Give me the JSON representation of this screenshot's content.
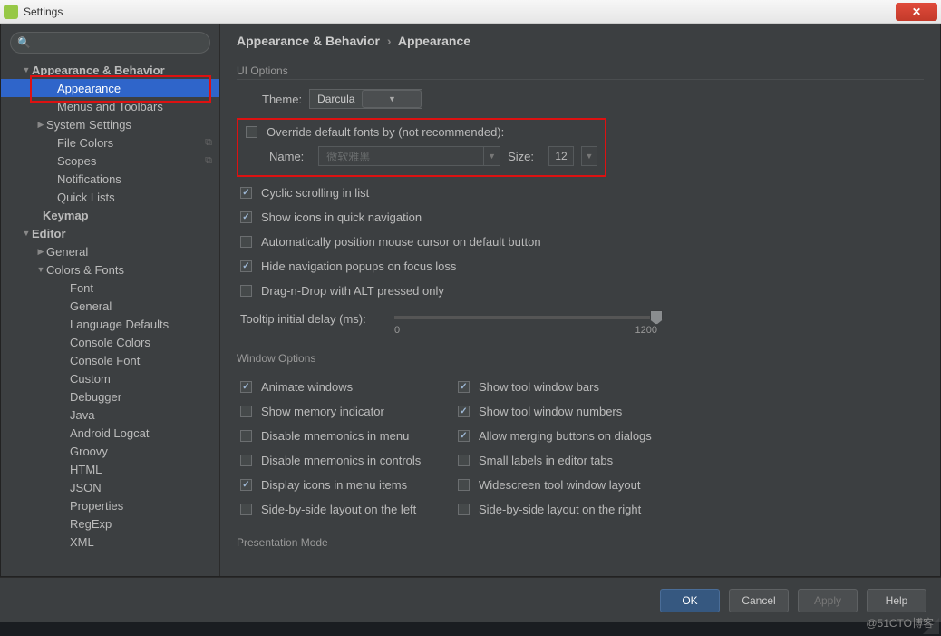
{
  "window": {
    "title": "Settings",
    "close_glyph": "✕"
  },
  "search": {
    "placeholder": "",
    "icon": "🔍"
  },
  "sidebar": {
    "items": [
      {
        "label": "Appearance & Behavior",
        "indent": 22,
        "arrow": "▼",
        "bold": true
      },
      {
        "label": "Appearance",
        "indent": 50,
        "selected": true,
        "redbox": true
      },
      {
        "label": "Menus and Toolbars",
        "indent": 50
      },
      {
        "label": "System Settings",
        "indent": 38,
        "arrow": "▶"
      },
      {
        "label": "File Colors",
        "indent": 50,
        "tail": "⧉"
      },
      {
        "label": "Scopes",
        "indent": 50,
        "tail": "⧉"
      },
      {
        "label": "Notifications",
        "indent": 50
      },
      {
        "label": "Quick Lists",
        "indent": 50
      },
      {
        "label": "Keymap",
        "indent": 34,
        "bold": true
      },
      {
        "label": "Editor",
        "indent": 22,
        "arrow": "▼",
        "bold": true
      },
      {
        "label": "General",
        "indent": 38,
        "arrow": "▶"
      },
      {
        "label": "Colors & Fonts",
        "indent": 38,
        "arrow": "▼"
      },
      {
        "label": "Font",
        "indent": 64
      },
      {
        "label": "General",
        "indent": 64
      },
      {
        "label": "Language Defaults",
        "indent": 64
      },
      {
        "label": "Console Colors",
        "indent": 64
      },
      {
        "label": "Console Font",
        "indent": 64
      },
      {
        "label": "Custom",
        "indent": 64
      },
      {
        "label": "Debugger",
        "indent": 64
      },
      {
        "label": "Java",
        "indent": 64
      },
      {
        "label": "Android Logcat",
        "indent": 64
      },
      {
        "label": "Groovy",
        "indent": 64
      },
      {
        "label": "HTML",
        "indent": 64
      },
      {
        "label": "JSON",
        "indent": 64
      },
      {
        "label": "Properties",
        "indent": 64
      },
      {
        "label": "RegExp",
        "indent": 64
      },
      {
        "label": "XML",
        "indent": 64
      }
    ]
  },
  "breadcrumb": {
    "a": "Appearance & Behavior",
    "sep": "›",
    "b": "Appearance"
  },
  "ui_options": {
    "heading": "UI Options",
    "theme_label": "Theme:",
    "theme_value": "Darcula",
    "override_label": "Override default fonts by (not recommended):",
    "name_label": "Name:",
    "name_placeholder": "微软雅黑",
    "size_label": "Size:",
    "size_value": "12",
    "checks": [
      {
        "label": "Cyclic scrolling in list",
        "on": true
      },
      {
        "label": "Show icons in quick navigation",
        "on": true
      },
      {
        "label": "Automatically position mouse cursor on default button",
        "on": false
      },
      {
        "label": "Hide navigation popups on focus loss",
        "on": true
      },
      {
        "label": "Drag-n-Drop with ALT pressed only",
        "on": false
      }
    ],
    "slider_label": "Tooltip initial delay (ms):",
    "slider_min": "0",
    "slider_max": "1200"
  },
  "window_options": {
    "heading": "Window Options",
    "left": [
      {
        "label": "Animate windows",
        "on": true
      },
      {
        "label": "Show memory indicator",
        "on": false
      },
      {
        "label": "Disable mnemonics in menu",
        "on": false
      },
      {
        "label": "Disable mnemonics in controls",
        "on": false
      },
      {
        "label": "Display icons in menu items",
        "on": true
      },
      {
        "label": "Side-by-side layout on the left",
        "on": false
      }
    ],
    "right": [
      {
        "label": "Show tool window bars",
        "on": true
      },
      {
        "label": "Show tool window numbers",
        "on": true
      },
      {
        "label": "Allow merging buttons on dialogs",
        "on": true
      },
      {
        "label": "Small labels in editor tabs",
        "on": false
      },
      {
        "label": "Widescreen tool window layout",
        "on": false
      },
      {
        "label": "Side-by-side layout on the right",
        "on": false
      }
    ]
  },
  "presentation": {
    "heading": "Presentation Mode"
  },
  "footer": {
    "ok": "OK",
    "cancel": "Cancel",
    "apply": "Apply",
    "help": "Help"
  },
  "watermark": "@51CTO博客"
}
